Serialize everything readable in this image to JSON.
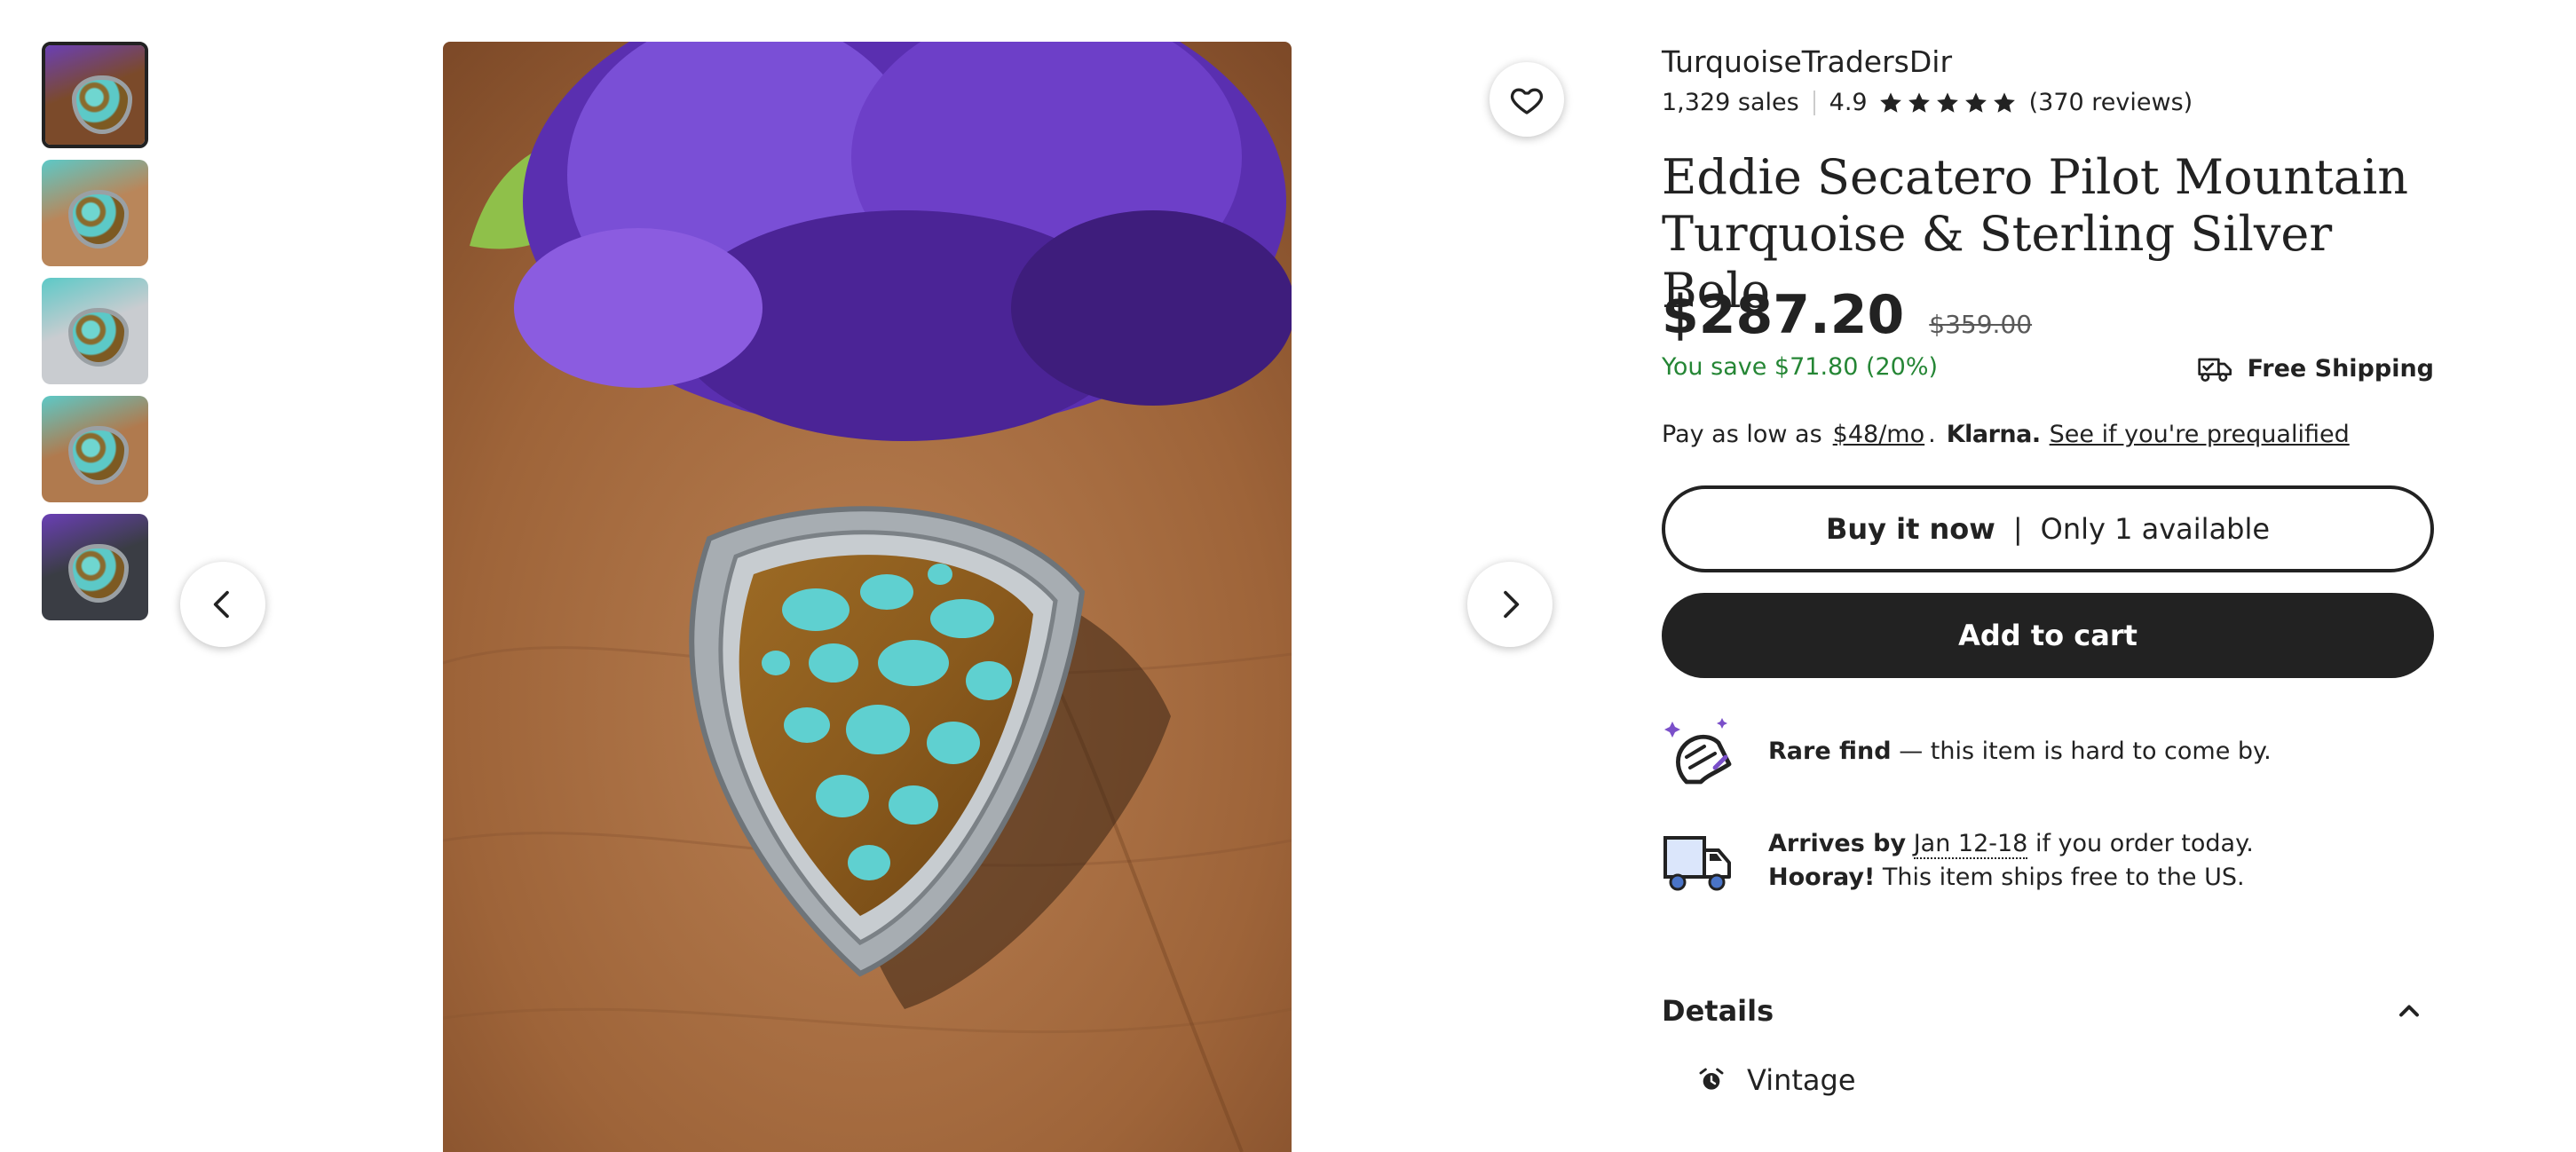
{
  "gallery": {
    "thumbnails": [
      {
        "label": "thumbnail 1",
        "bg": "#7b4a2a",
        "accent": "#6a3fb5"
      },
      {
        "label": "thumbnail 2",
        "bg": "#b9865a",
        "accent": "#5cc9c7"
      },
      {
        "label": "thumbnail 3",
        "bg": "#c9ccd0",
        "accent": "#5cc9c7"
      },
      {
        "label": "thumbnail 4",
        "bg": "#b07a4e",
        "accent": "#5cc9c7"
      },
      {
        "label": "thumbnail 5",
        "bg": "#3a3d44",
        "accent": "#6a3fb5"
      }
    ],
    "active_index": 0
  },
  "shop": {
    "name": "TurquoiseTradersDir",
    "sales": "1,329 sales",
    "rating": "4.9",
    "stars": 5,
    "reviews": "(370 reviews)"
  },
  "listing": {
    "title": "Eddie Secatero Pilot Mountain Turquoise & Sterling Silver Bolo",
    "price": "$287.20",
    "original_price": "$359.00",
    "savings": "You save $71.80 (20%)",
    "free_shipping": "Free Shipping"
  },
  "klarna": {
    "prefix": "Pay as low as",
    "amount": "$48/mo",
    "dot": ".",
    "brand": "Klarna.",
    "link": "See if you're prequalified"
  },
  "buttons": {
    "buy_now": "Buy it now",
    "separator": "|",
    "availability": "Only 1 available",
    "add_to_cart": "Add to cart"
  },
  "rare": {
    "bold": "Rare find",
    "rest": " — this item is hard to come by."
  },
  "shipping": {
    "arrives_bold": "Arrives by",
    "date": "Jan 12-18",
    "arrives_rest": " if you order today.",
    "hooray_bold": "Hooray!",
    "hooray_rest": " This item ships free to the US."
  },
  "details": {
    "heading": "Details",
    "vintage": "Vintage"
  },
  "colors": {
    "text": "#222222",
    "savings_green": "#258635",
    "button_dark": "#222222",
    "truck_blue": "#4a74c7",
    "rare_purple": "#7a4fc9"
  }
}
